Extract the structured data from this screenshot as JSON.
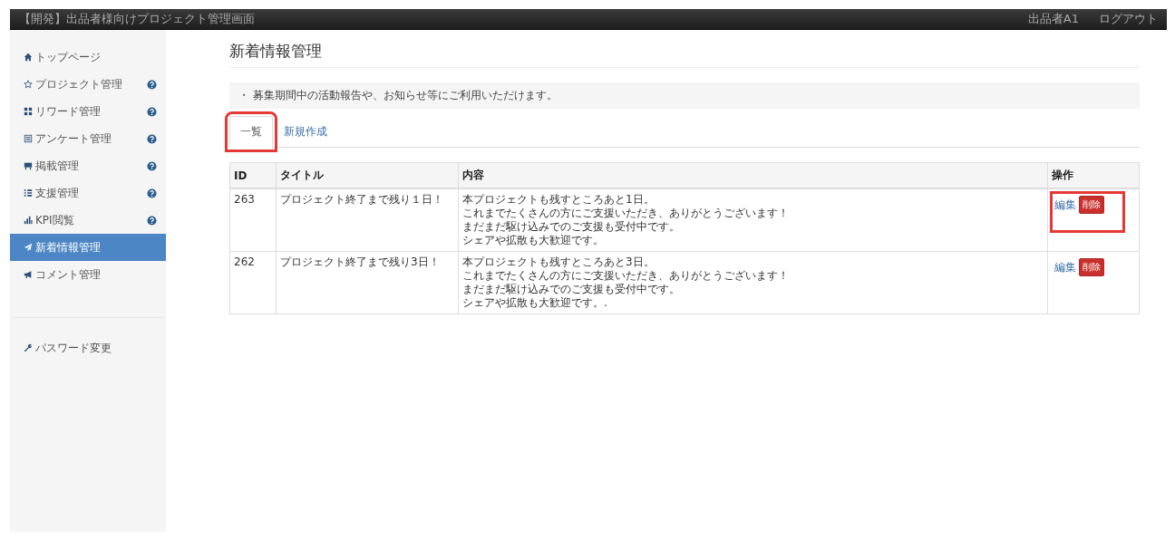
{
  "header": {
    "title": "【開発】出品者様向けプロジェクト管理画面",
    "user": "出品者A1",
    "logout": "ログアウト"
  },
  "sidebar": {
    "items": [
      {
        "label": "トップページ",
        "help": false,
        "selected": false
      },
      {
        "label": "プロジェクト管理",
        "help": true,
        "selected": false
      },
      {
        "label": "リワード管理",
        "help": true,
        "selected": false
      },
      {
        "label": "アンケート管理",
        "help": true,
        "selected": false
      },
      {
        "label": "掲載管理",
        "help": true,
        "selected": false
      },
      {
        "label": "支援管理",
        "help": true,
        "selected": false
      },
      {
        "label": "KPI閲覧",
        "help": true,
        "selected": false
      },
      {
        "label": "新着情報管理",
        "help": false,
        "selected": true
      },
      {
        "label": "コメント管理",
        "help": false,
        "selected": false
      }
    ],
    "footer_items": [
      {
        "label": "パスワード変更"
      }
    ]
  },
  "page": {
    "title": "新着情報管理",
    "notice": "・ 募集期間中の活動報告や、お知らせ等にご利用いただけます。"
  },
  "tabs": [
    {
      "label": "一覧",
      "selected": true,
      "highlighted": true
    },
    {
      "label": "新規作成",
      "selected": false,
      "highlighted": false
    }
  ],
  "table": {
    "columns": [
      "ID",
      "タイトル",
      "内容",
      "操作"
    ],
    "rows": [
      {
        "id": "263",
        "title": "プロジェクト終了まで残り１日！",
        "content": [
          "本プロジェクトも残すところあと1日。",
          "これまでたくさんの方にご支援いただき、ありがとうございます！",
          "まだまだ駆け込みでのご支援も受付中です。",
          "シェアや拡散も大歓迎です。"
        ],
        "edit": "編集",
        "delete": "削除",
        "highlighted": true
      },
      {
        "id": "262",
        "title": "プロジェクト終了まで残り3日！",
        "content": [
          "本プロジェクトも残すところあと3日。",
          "これまでたくさんの方にご支援いただき、ありがとうございます！",
          "まだまだ駆け込みでのご支援も受付中です。",
          "シェアや拡散も大歓迎です。."
        ],
        "edit": "編集",
        "delete": "削除",
        "highlighted": false
      }
    ]
  }
}
